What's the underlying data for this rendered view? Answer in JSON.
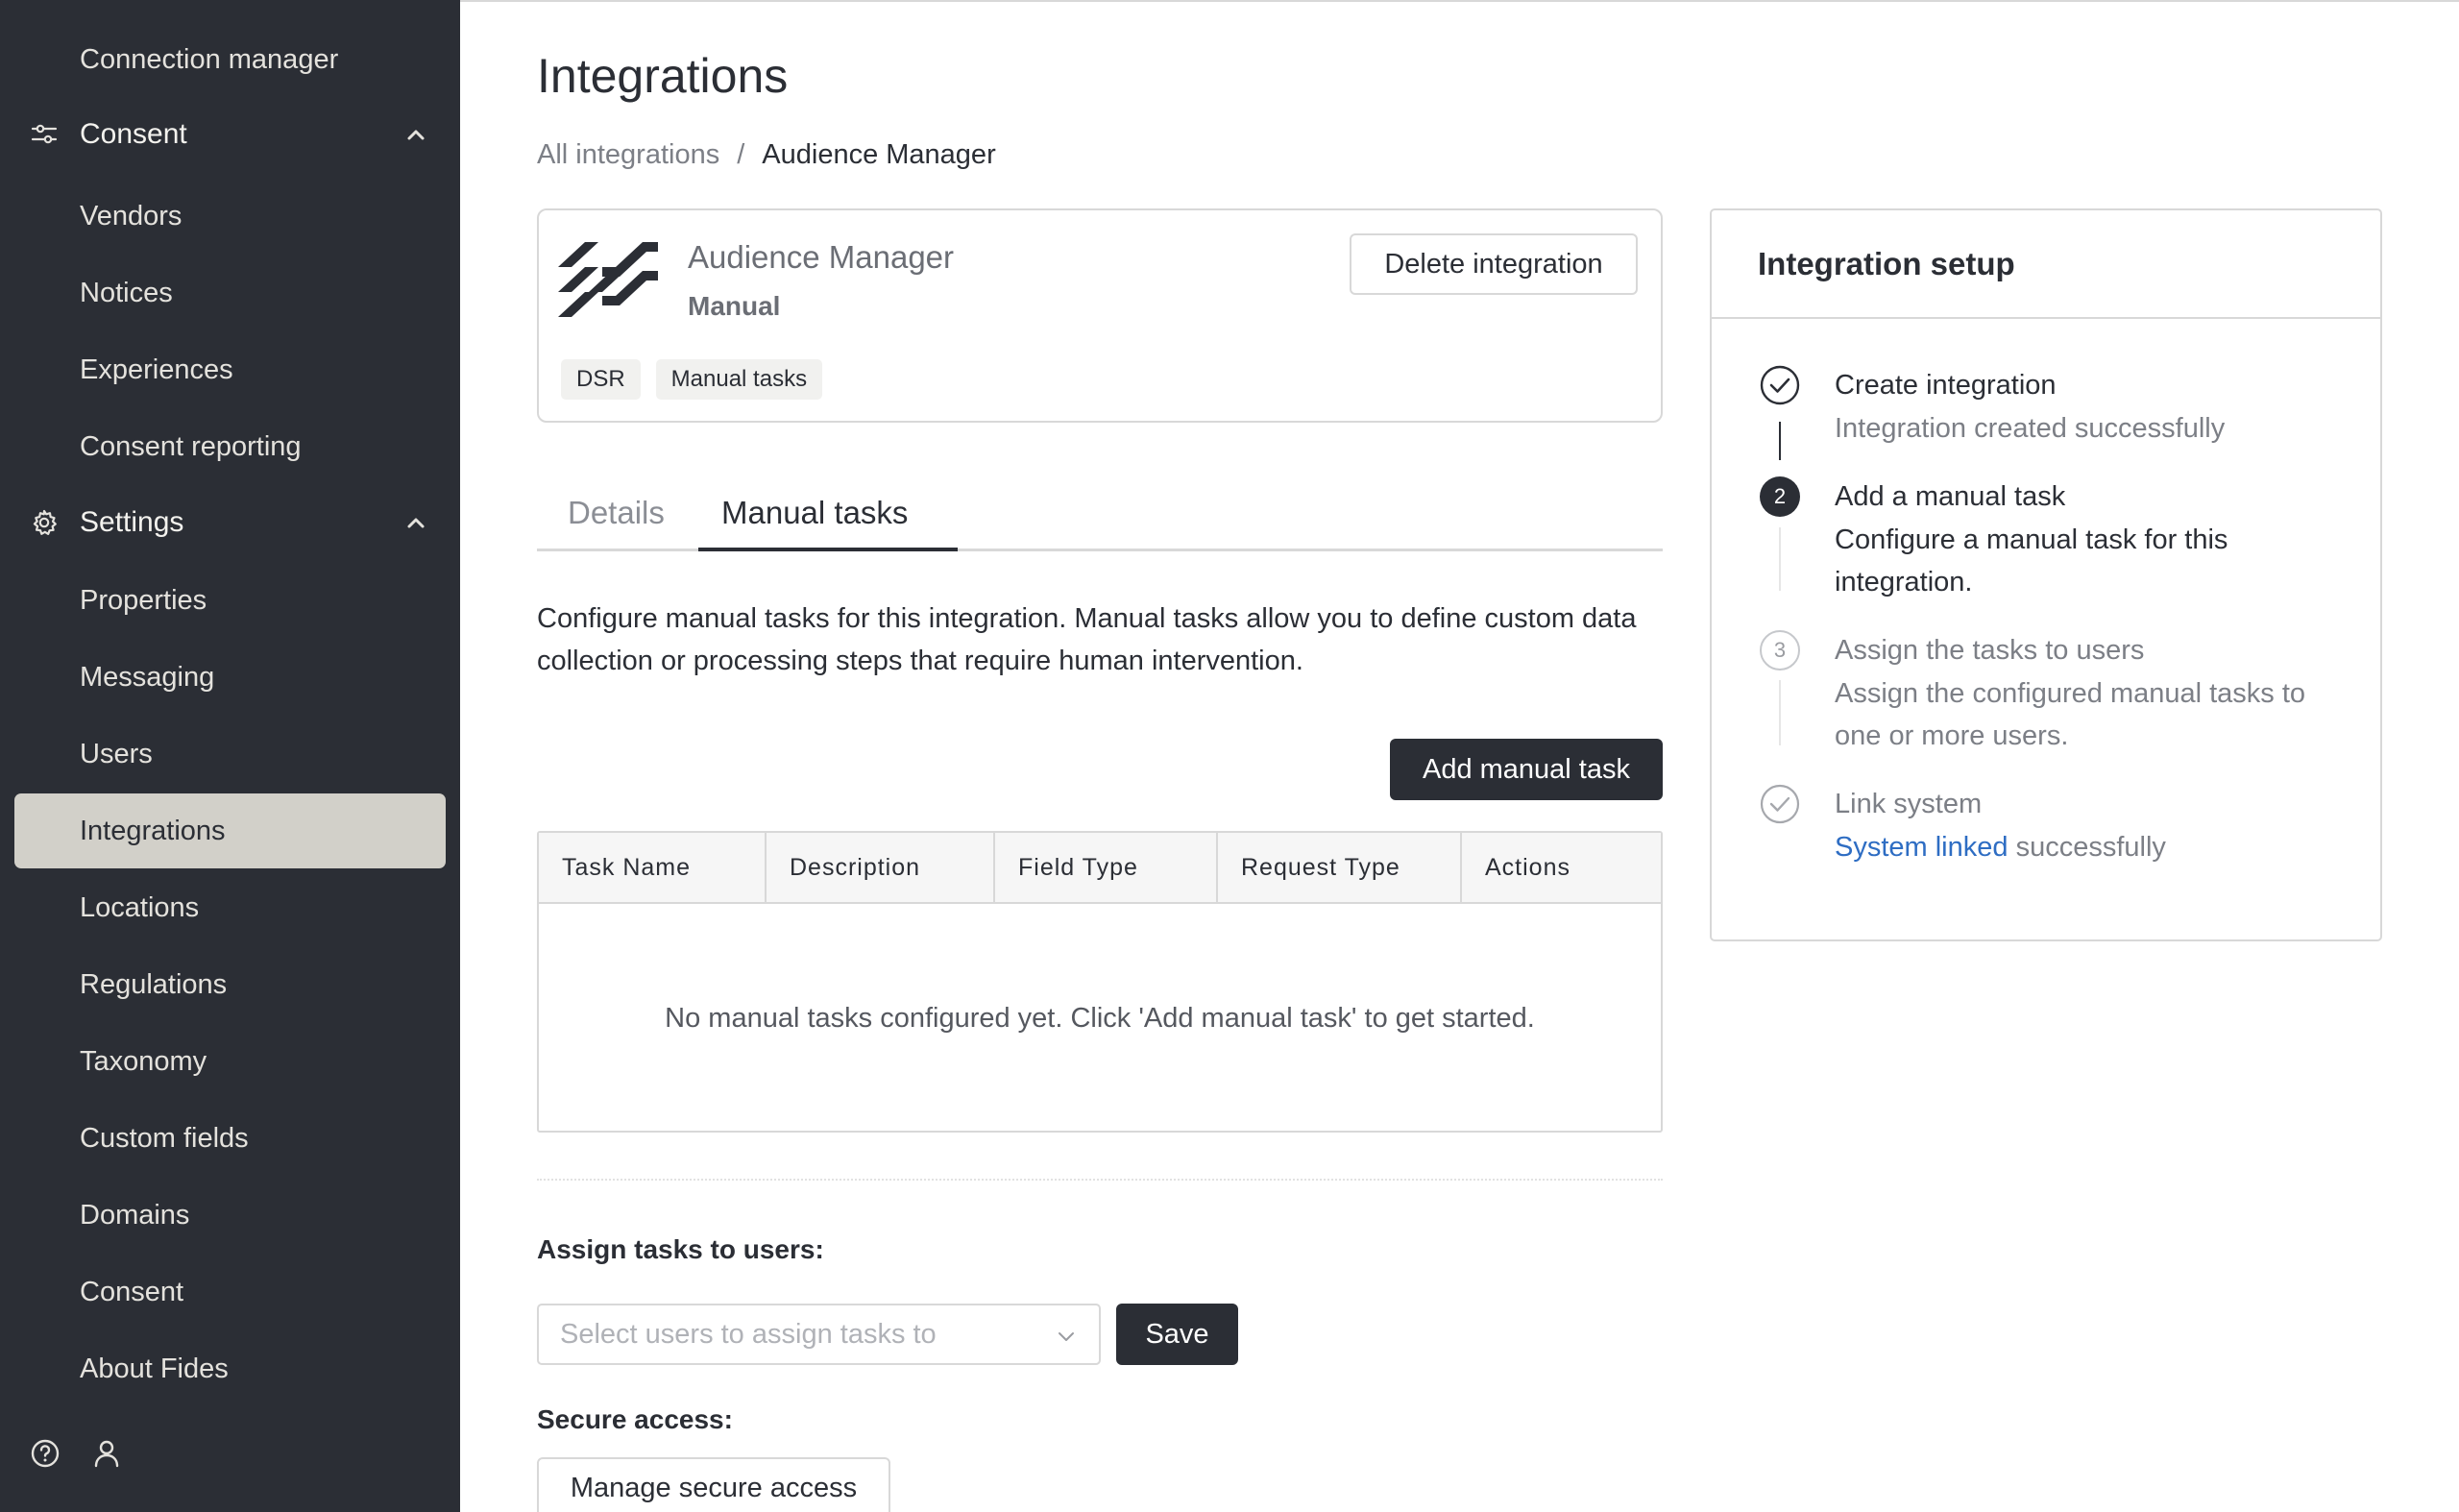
{
  "sidebar": {
    "items": [
      {
        "label": "Connection manager"
      },
      {
        "label": "Consent",
        "group": true
      },
      {
        "label": "Vendors"
      },
      {
        "label": "Notices"
      },
      {
        "label": "Experiences"
      },
      {
        "label": "Consent reporting"
      },
      {
        "label": "Settings",
        "group": true
      },
      {
        "label": "Properties"
      },
      {
        "label": "Messaging"
      },
      {
        "label": "Users"
      },
      {
        "label": "Integrations",
        "active": true
      },
      {
        "label": "Locations"
      },
      {
        "label": "Regulations"
      },
      {
        "label": "Taxonomy"
      },
      {
        "label": "Custom fields"
      },
      {
        "label": "Domains"
      },
      {
        "label": "Consent"
      },
      {
        "label": "About Fides"
      }
    ]
  },
  "page": {
    "title": "Integrations",
    "breadcrumb": {
      "parent": "All integrations",
      "separator": "/",
      "current": "Audience Manager"
    }
  },
  "integration": {
    "name": "Audience Manager",
    "type": "Manual",
    "delete_label": "Delete integration",
    "tags": [
      "DSR",
      "Manual tasks"
    ]
  },
  "tabs": {
    "details": "Details",
    "manual_tasks": "Manual tasks",
    "active": "Manual tasks"
  },
  "manual_tasks": {
    "description": "Configure manual tasks for this integration. Manual tasks allow you to define custom data collection or processing steps that require human intervention.",
    "add_label": "Add manual task",
    "columns": [
      "Task Name",
      "Description",
      "Field Type",
      "Request Type",
      "Actions"
    ],
    "empty_message": "No manual tasks configured yet. Click 'Add manual task' to get started."
  },
  "assign": {
    "label": "Assign tasks to users:",
    "placeholder": "Select users to assign tasks to",
    "save_label": "Save"
  },
  "secure": {
    "label": "Secure access:",
    "button_label": "Manage secure access"
  },
  "setup": {
    "title": "Integration setup",
    "steps": [
      {
        "title": "Create integration",
        "desc": "Integration created successfully",
        "status": "complete"
      },
      {
        "number": "2",
        "title": "Add a manual task",
        "desc": "Configure a manual task for this integration.",
        "status": "current"
      },
      {
        "number": "3",
        "title": "Assign the tasks to users",
        "desc": "Assign the configured manual tasks to one or more users.",
        "status": "pending"
      },
      {
        "title": "Link system",
        "link": "System linked",
        "desc_suffix": " successfully",
        "status": "pending-check"
      }
    ]
  },
  "colors": {
    "sidebar_bg": "#2b2e35",
    "active_item_bg": "#d2d0c9",
    "primary_button": "#2b2e35",
    "link": "#2e6dc3"
  }
}
